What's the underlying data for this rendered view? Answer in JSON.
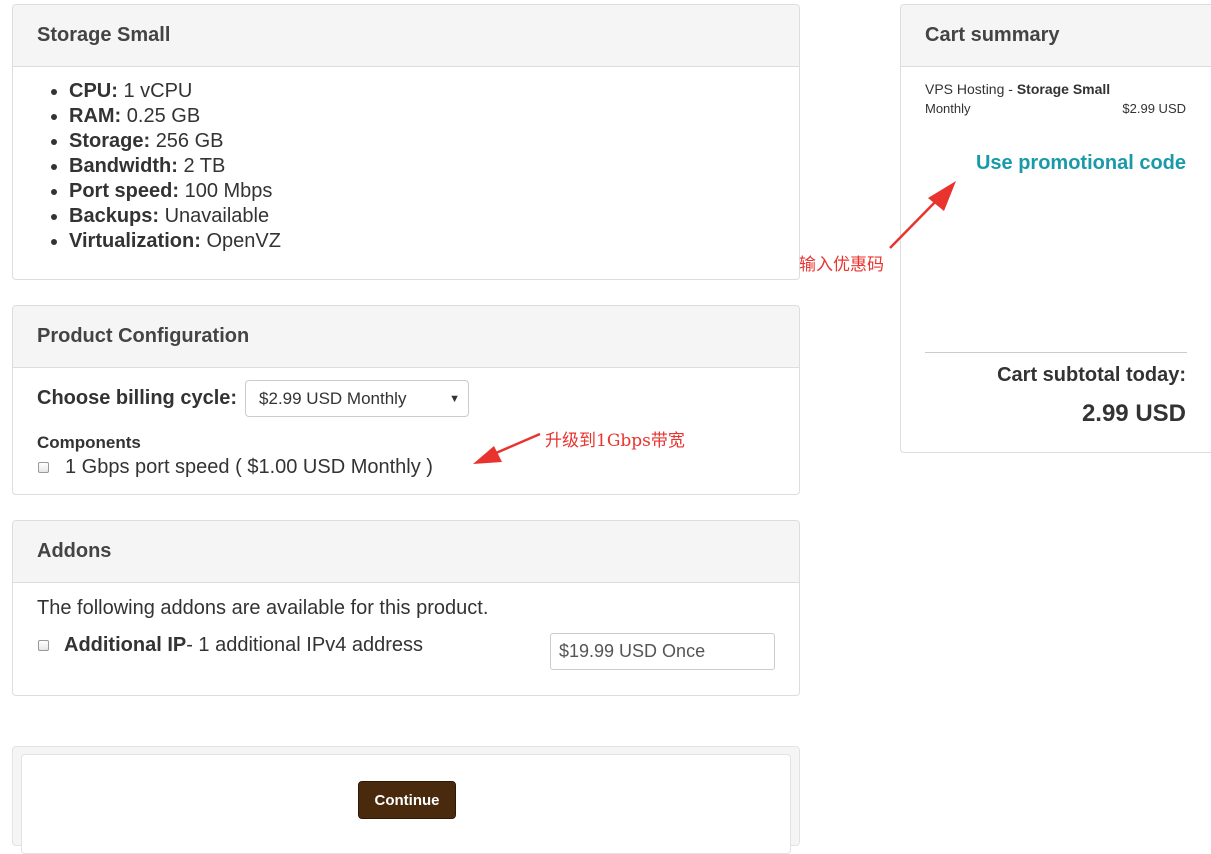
{
  "product_panel": {
    "title": "Storage Small",
    "specs": [
      {
        "label": "CPU:",
        "value": "1 vCPU"
      },
      {
        "label": "RAM:",
        "value": "0.25 GB"
      },
      {
        "label": "Storage:",
        "value": "256 GB"
      },
      {
        "label": "Bandwidth:",
        "value": "2 TB"
      },
      {
        "label": "Port speed:",
        "value": "100 Mbps"
      },
      {
        "label": "Backups:",
        "value": "Unavailable"
      },
      {
        "label": "Virtualization:",
        "value": "OpenVZ"
      }
    ]
  },
  "config_panel": {
    "title": "Product Configuration",
    "billing_label": "Choose billing cycle:",
    "billing_selected": "$2.99 USD Monthly",
    "components_label": "Components",
    "component_option": "1 Gbps port speed ( $1.00 USD Monthly )",
    "component_checked": false
  },
  "addons_panel": {
    "title": "Addons",
    "intro": "The following addons are available for this product.",
    "addon_name": "Additional IP",
    "addon_desc": " - 1 additional IPv4 address",
    "addon_price": "$19.99 USD Once",
    "addon_checked": false
  },
  "continue_button": {
    "label": "Continue",
    "color": "#4a2a0c"
  },
  "cart": {
    "title": "Cart summary",
    "item_category": "VPS Hosting - ",
    "item_name": "Storage Small",
    "item_cycle": "Monthly",
    "item_price": "$2.99 USD",
    "promo_link": "Use promotional code",
    "promo_color": "#1a9aa8",
    "subtotal_label": "Cart subtotal today:",
    "subtotal_value": "2.99 USD"
  },
  "annotations": {
    "promo_note": "输入优惠码",
    "upgrade_note": "升级到1Gbps带宽",
    "color": "#e8332f"
  }
}
